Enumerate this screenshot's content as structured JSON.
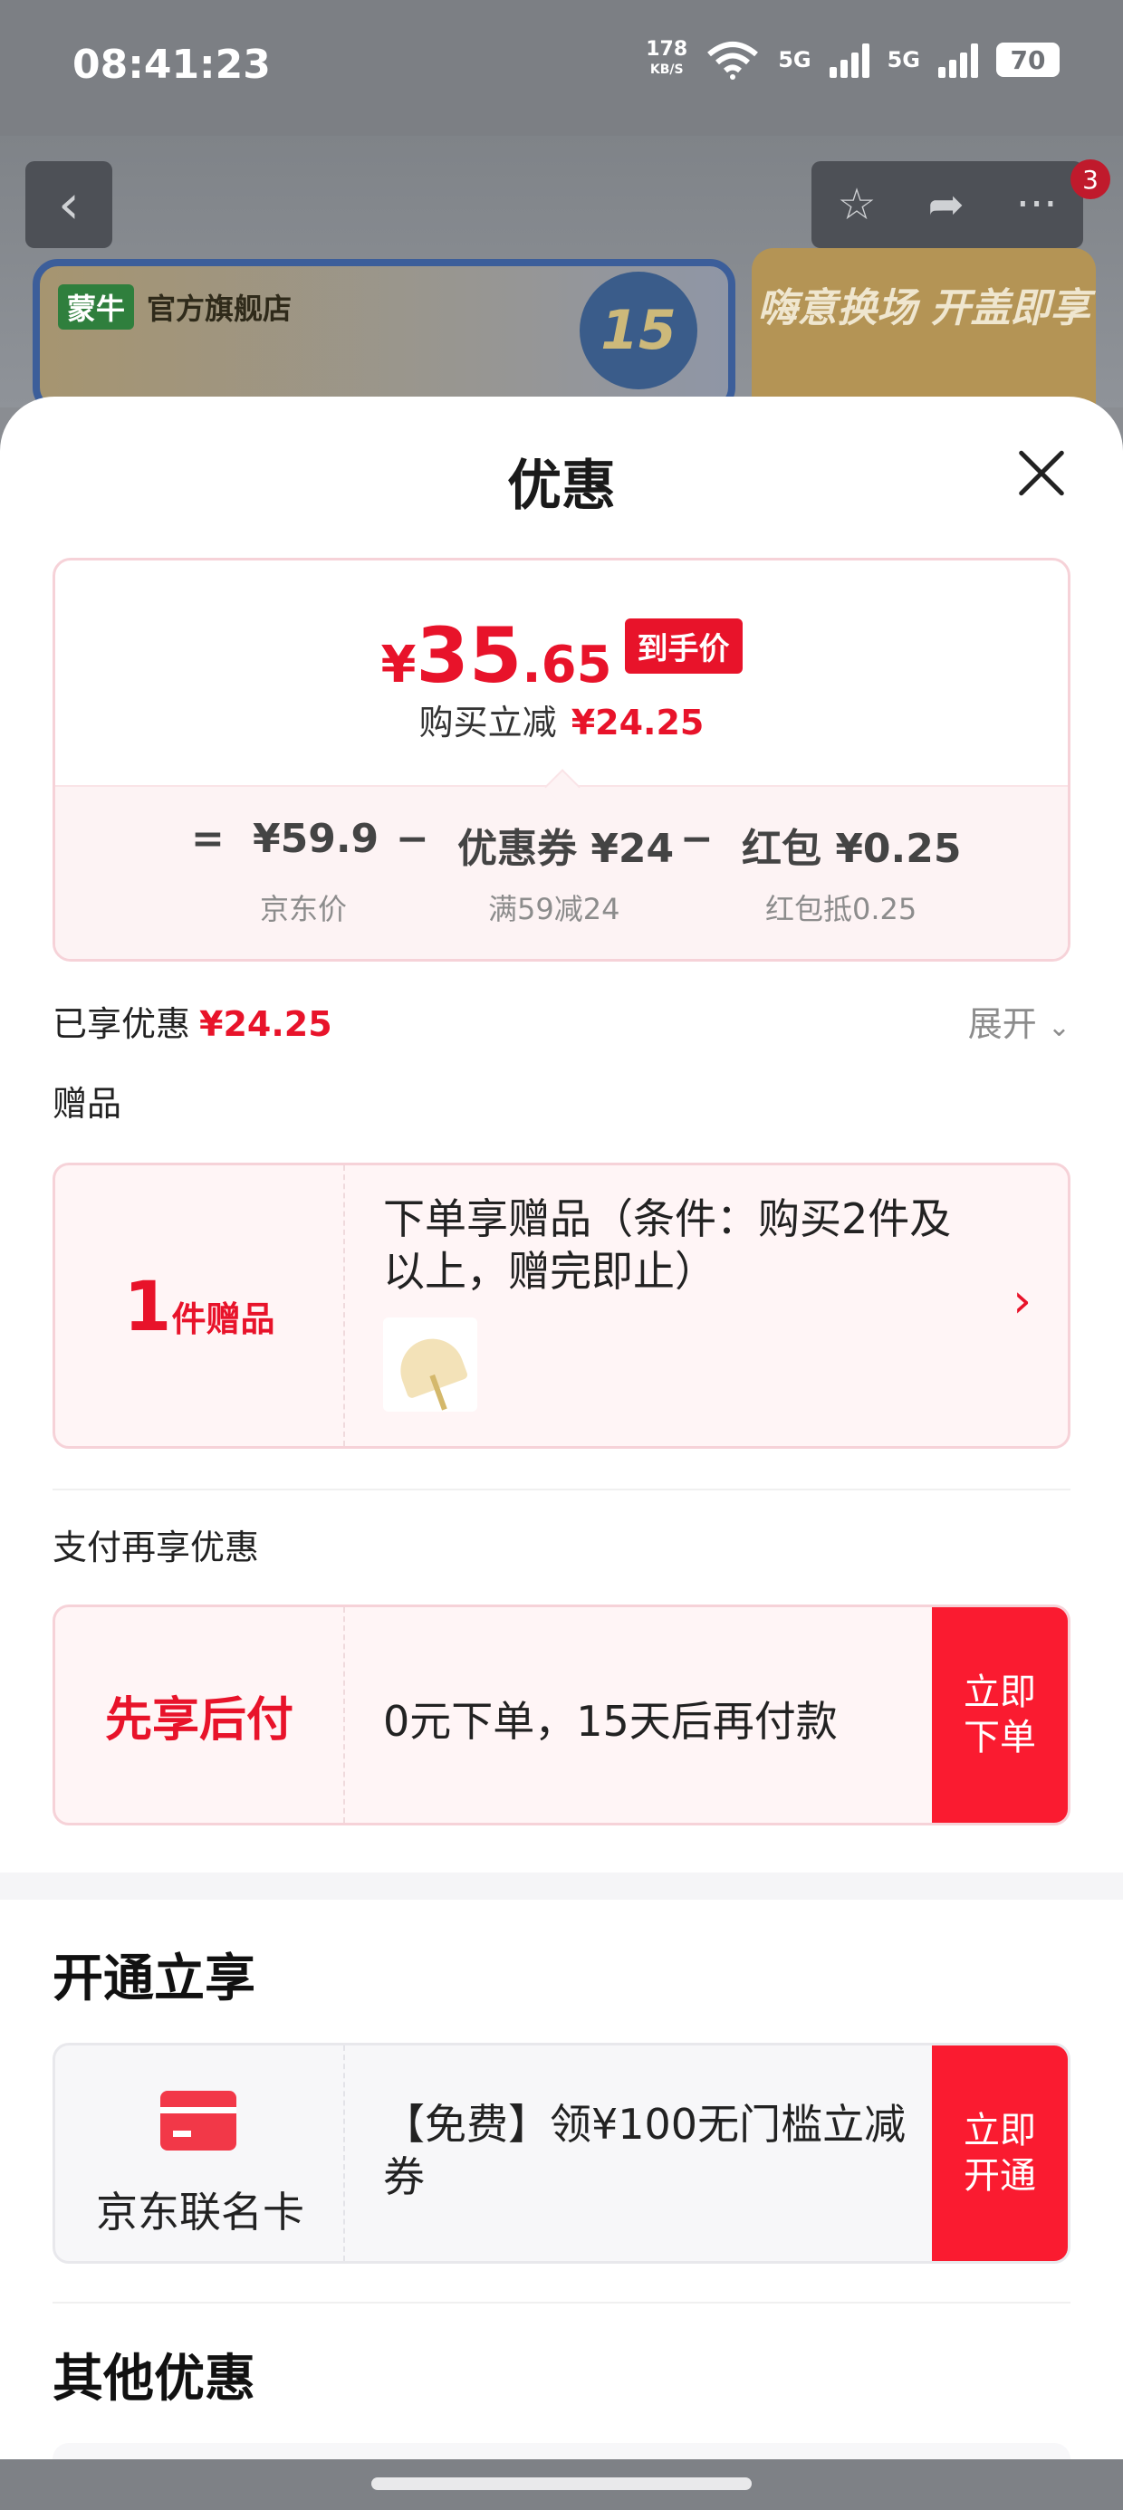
{
  "status_bar": {
    "time": "08:41:23",
    "speed_value": "178",
    "speed_unit": "KB/S",
    "sim1": "5G",
    "sim2": "5G",
    "battery": "70"
  },
  "store": {
    "logo_text": "蒙牛",
    "name": "官方旗舰店",
    "badge": "15",
    "promo": "嗨意换场 开盖即享",
    "notification_count": "3"
  },
  "sheet": {
    "title": "优惠",
    "final_price": {
      "currency": "¥",
      "integer": "35",
      "decimal": ".65",
      "tag": "到手价"
    },
    "reduction_label": "购买立减",
    "reduction_value": "¥24.25",
    "breakdown": {
      "equals": "=",
      "jd_price": "¥59.9",
      "jd_price_label": "京东价",
      "minus1": "−",
      "coupon": "优惠券 ¥24",
      "coupon_label": "满59减24",
      "minus2": "−",
      "redpacket": "红包 ¥0.25",
      "redpacket_label": "红包抵0.25"
    },
    "enjoyed_label": "已享优惠",
    "enjoyed_value": "¥24.25",
    "expand_label": "展开",
    "gift_section": "赠品",
    "gift": {
      "count": "1",
      "unit": "件赠品",
      "text": "下单享赠品（条件：购买2件及以上，赠完即止）"
    },
    "pay_section": "支付再享优惠",
    "pay": {
      "name": "先享后付",
      "text": "0元下单，15天后再付款",
      "button": "立即下单"
    },
    "open_section": "开通立享",
    "card": {
      "name": "京东联名卡",
      "text": "【免费】领¥100无门槛立减券",
      "button": "立即开通"
    },
    "other_section": "其他优惠"
  }
}
